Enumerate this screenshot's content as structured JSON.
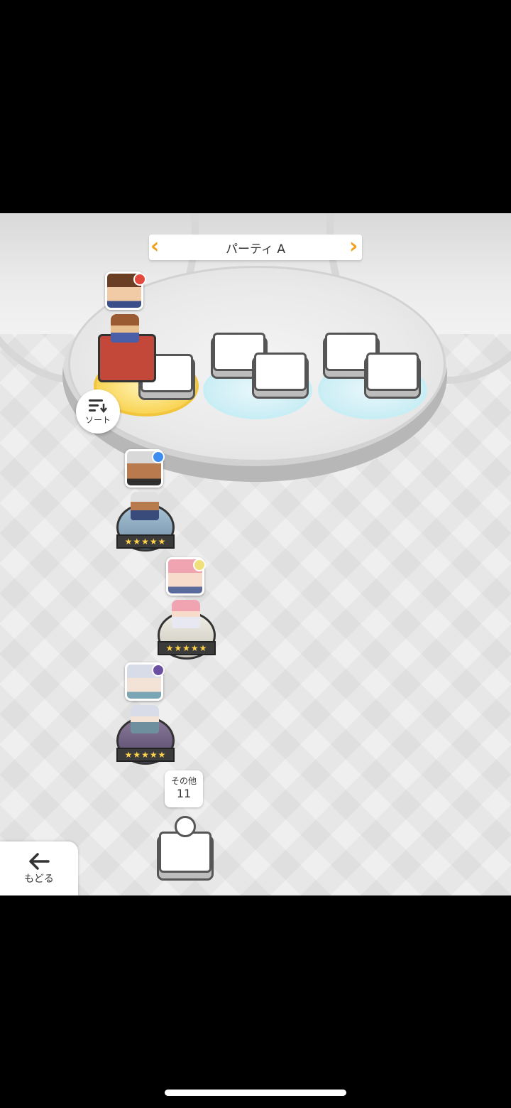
{
  "party": {
    "name": "パーティ A"
  },
  "sort": {
    "label": "ソート"
  },
  "back": {
    "label": "もどる"
  },
  "others": {
    "label": "その他",
    "count": "11"
  },
  "roster": [
    {
      "element_color": "#e2483c",
      "stars": "★★★★★"
    },
    {
      "element_color": "#3e8cf0",
      "stars": "★★★★★"
    },
    {
      "element_color": "#f0e07a",
      "stars": "★★★★★"
    },
    {
      "element_color": "#6b4fa0",
      "stars": "★★★★★"
    }
  ],
  "icons": {
    "sort": "sort-icon",
    "back": "arrow-left-icon",
    "prev": "chevron-left-icon",
    "next": "chevron-right-icon"
  }
}
